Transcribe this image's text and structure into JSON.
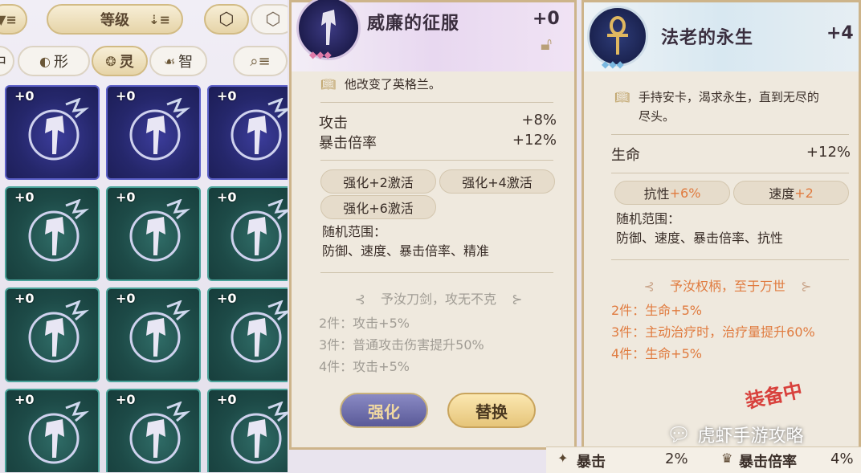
{
  "filters": {
    "sort_label": "等级",
    "tab_body": "形",
    "tab_spirit": "灵",
    "tab_mind": "智",
    "tab_partial": "中"
  },
  "inventory": {
    "cards": [
      {
        "level": "+0",
        "theme": "blue"
      },
      {
        "level": "+0",
        "theme": "blue"
      },
      {
        "level": "+0",
        "theme": "blue"
      },
      {
        "level": "+0",
        "theme": "green"
      },
      {
        "level": "+0",
        "theme": "green"
      },
      {
        "level": "+0",
        "theme": "green"
      },
      {
        "level": "+0",
        "theme": "green"
      },
      {
        "level": "+0",
        "theme": "green"
      },
      {
        "level": "+0",
        "theme": "green"
      },
      {
        "level": "+0",
        "theme": "green"
      },
      {
        "level": "+0",
        "theme": "green"
      },
      {
        "level": "+0",
        "theme": "green"
      }
    ]
  },
  "item1": {
    "name": "威廉的征服",
    "level": "+0",
    "description": "他改变了英格兰。",
    "stats": [
      {
        "label": "攻击",
        "value": "+8%"
      },
      {
        "label": "暴击倍率",
        "value": "+12%"
      }
    ],
    "chips": [
      "强化+2激活",
      "强化+4激活",
      "强化+6激活"
    ],
    "random_label": "随机范围：",
    "random_values": "防御、速度、暴击倍率、精准",
    "set_title": "予汝刀剑，攻无不克",
    "set_bonuses": [
      "2件：攻击+5%",
      "3件：普通攻击伤害提升50%",
      "4件：攻击+5%"
    ],
    "btn_enhance": "强化",
    "btn_replace": "替换"
  },
  "item2": {
    "name": "法老的永生",
    "level": "+4",
    "description_line1": "手持安卡，渴求永生，直到无尽的",
    "description_line2": "尽头。",
    "stats": [
      {
        "label": "生命",
        "value": "+12%"
      }
    ],
    "chips": [
      {
        "label": "抗性",
        "value": "+6%"
      },
      {
        "label": "速度",
        "value": "+2"
      }
    ],
    "random_label": "随机范围：",
    "random_values": "防御、速度、暴击倍率、抗性",
    "set_title": "予汝权柄，至于万世",
    "set_bonuses": [
      "2件：生命+5%",
      "3件：主动治疗时，治疗量提升60%",
      "4件：生命+5%"
    ],
    "equipped_stamp": "装备中"
  },
  "bottom": {
    "left_label": "暴击",
    "left_value": "2%",
    "right_label": "暴击倍率",
    "right_value": "4%"
  },
  "watermark": "虎虾手游攻略"
}
